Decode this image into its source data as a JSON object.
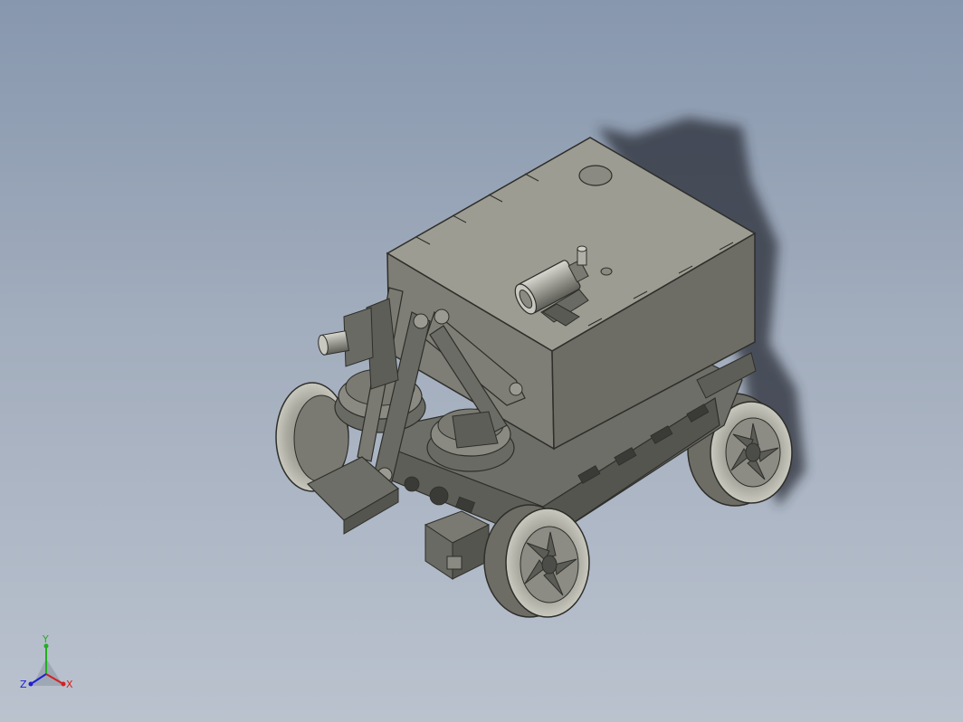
{
  "scene": {
    "model": "robot-car-with-arm",
    "colors": {
      "background_top": "#8797ae",
      "background_bottom": "#bac2ce",
      "box_top": "#9c9c92",
      "box_front": "#7e7e76",
      "box_side": "#6d6d66",
      "metal_dark": "#5a5a54",
      "metal_mid": "#8a8a82",
      "tire": "#a9a99f",
      "edge": "#2e2e2a",
      "shadow": "#2a2f38"
    }
  },
  "triad": {
    "x_label": "X",
    "y_label": "Y",
    "z_label": "Z",
    "colors": {
      "x": "#d42020",
      "y": "#20b020",
      "z": "#2020d0"
    }
  }
}
